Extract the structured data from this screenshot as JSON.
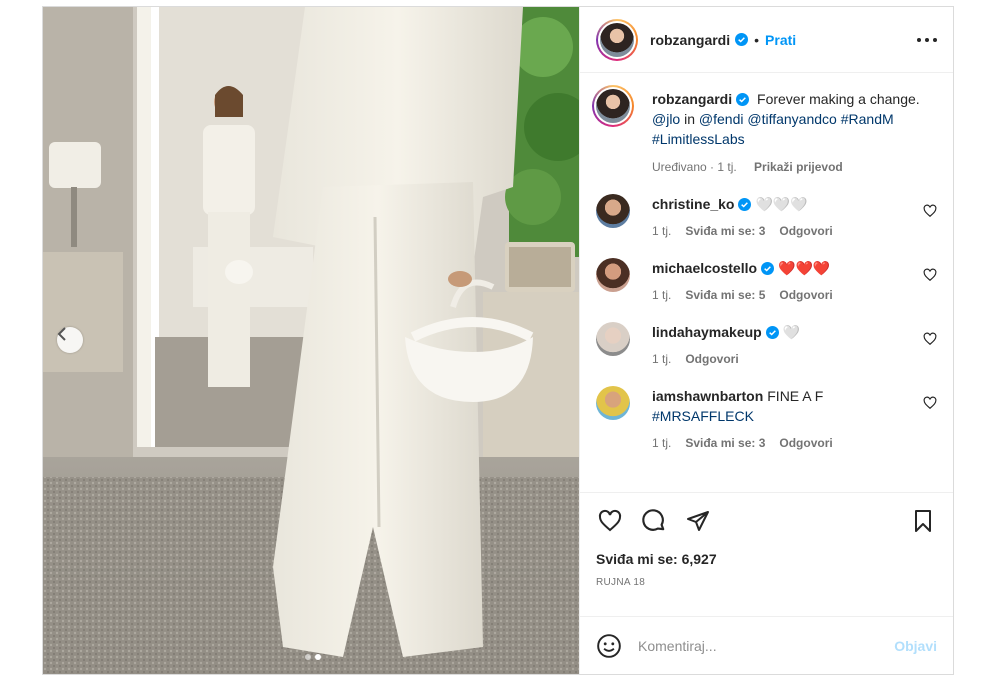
{
  "post": {
    "author": "robzangardi",
    "separator": "•",
    "follow_label": "Prati"
  },
  "caption": {
    "username": "robzangardi",
    "text_start": "Forever making a change.",
    "mention_1": "@jlo",
    "text_in": "in",
    "mention_2": "@fendi",
    "mention_3": "@tiffanyandco",
    "hashtag_1": "#RandM",
    "hashtag_2": "#LimitlessLabs",
    "edited": "Uređivano · 1 tj.",
    "translate": "Prikaži prijevod"
  },
  "comments": [
    {
      "username": "christine_ko",
      "text": "🤍🤍🤍",
      "time": "1 tj.",
      "likes": "Sviđa mi se: 3",
      "reply": "Odgovori"
    },
    {
      "username": "michaelcostello",
      "text": "❤️❤️❤️",
      "time": "1 tj.",
      "likes": "Sviđa mi se: 5",
      "reply": "Odgovori"
    },
    {
      "username": "lindahaymakeup",
      "text": "🤍",
      "time": "1 tj.",
      "reply": "Odgovori"
    },
    {
      "username": "iamshawnbarton",
      "text": "FINE A F",
      "hashtag": "#MRSAFFLECK",
      "time": "1 tj.",
      "likes": "Sviđa mi se: 3",
      "reply": "Odgovori"
    }
  ],
  "likes_text": "Sviđa mi se: 6,927",
  "date": "RUJNA 18",
  "comment_box": {
    "placeholder": "Komentiraj...",
    "post_label": "Objavi"
  },
  "icons": {
    "more": "more-horizontal-icon",
    "like": "heart-icon",
    "comment": "comment-icon",
    "share": "share-icon",
    "save": "bookmark-icon",
    "emoji": "emoji-icon",
    "verified": "verified-badge-icon",
    "prev": "chevron-left-icon"
  },
  "colors": {
    "link": "#0095f6",
    "mention": "#00376b",
    "post_disabled": "#b2dffc",
    "verified": "#0095f6"
  }
}
